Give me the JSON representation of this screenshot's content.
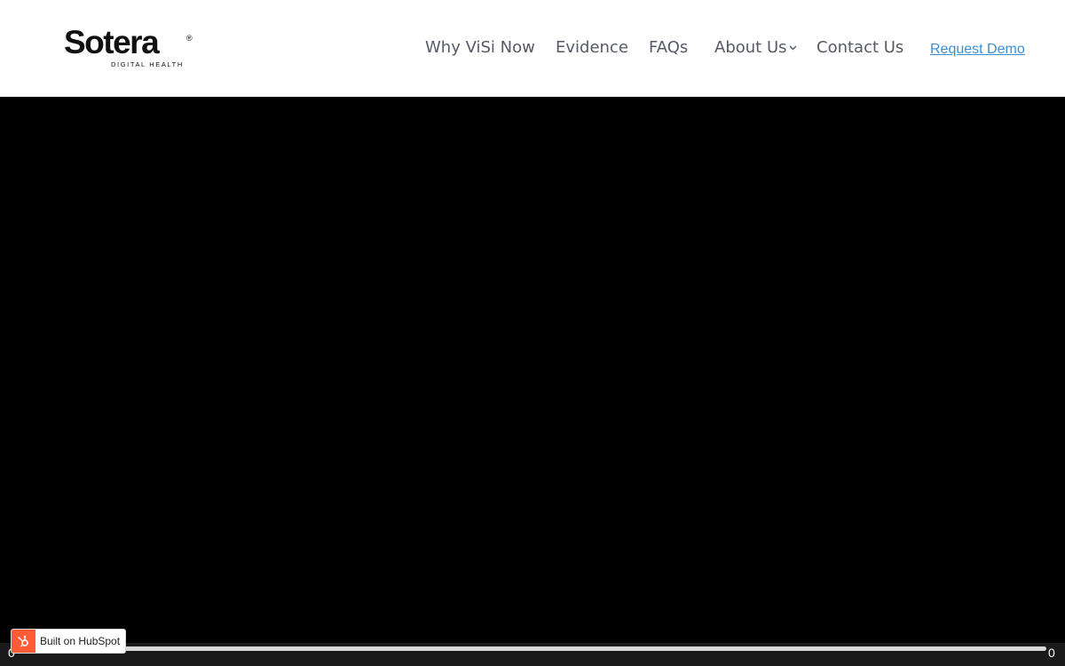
{
  "header": {
    "logo": {
      "wordmark": "Sotera",
      "registered": "®",
      "tagline": "DIGITAL HEALTH"
    },
    "nav": [
      {
        "label": "Why ViSi Now"
      },
      {
        "label": "Evidence"
      },
      {
        "label": "FAQs"
      },
      {
        "label": "About Us",
        "has_dropdown": true
      },
      {
        "label": "Contact Us"
      }
    ],
    "cta_label": "Request Demo"
  },
  "video": {
    "time_elapsed": "0",
    "time_total": "0",
    "progress": 0
  },
  "badge": {
    "label": "Built on HubSpot",
    "icon": "hubspot-sprocket-icon"
  },
  "colors": {
    "nav_text": "#555a66",
    "cta_link": "#3d8fd1",
    "hubspot_orange": "#ff5c35",
    "video_background": "#000000"
  }
}
